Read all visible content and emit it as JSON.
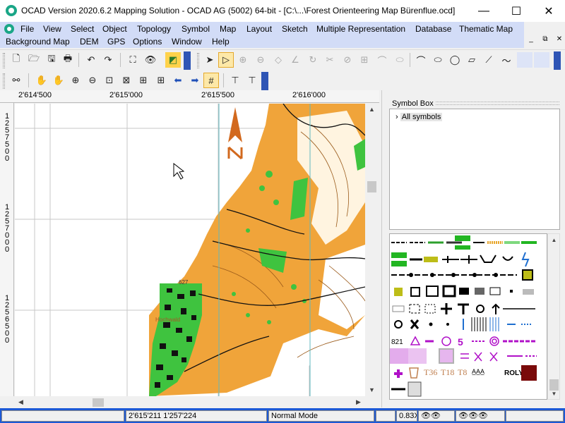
{
  "window": {
    "title": "OCAD Version 2020.6.2 Mapping Solution - OCAD AG (5002) 64-bit - [C:\\...\\Forest Orienteering Map Bürenflue.ocd]",
    "minimize_glyph": "—",
    "maximize_glyph": "☐",
    "close_glyph": "✕"
  },
  "menu": {
    "items": [
      "File",
      "View",
      "Select",
      "Object",
      "Topology",
      "Symbol",
      "Map",
      "Layout",
      "Sketch",
      "Multiple Representation",
      "Database",
      "Thematic Map",
      "Background Map",
      "DEM",
      "GPS",
      "Options",
      "Window",
      "Help"
    ],
    "mdi_minimize": "_",
    "mdi_restore": "⧉",
    "mdi_close": "✕"
  },
  "toolbar1": {
    "icons": [
      "new-file-icon",
      "open-folder-icon",
      "save-icon",
      "print-icon",
      "undo-icon",
      "redo-icon",
      "fullscreen-icon",
      "eye-icon",
      "layers-icon",
      "pointer-icon",
      "edit-object-icon",
      "add-vertex-icon",
      "remove-vertex-icon",
      "move-vertex-icon",
      "straight-corner-icon",
      "rotate-icon",
      "cut-icon",
      "cut-hole-icon",
      "merge-icon",
      "curve-icon",
      "ellipse-icon",
      "circle-icon",
      "rectangle-icon",
      "line-icon",
      "freehand-icon"
    ],
    "glyphs": [
      "🗋",
      "🗁",
      "🖫",
      "🖶",
      "↶",
      "↷",
      "⛶",
      "👁",
      "◩",
      "➤",
      "▷",
      "⊕",
      "⊖",
      "◇",
      "∠",
      "↻",
      "✂",
      "⊘",
      "⊞",
      "⌒",
      "⬭",
      "◯",
      "▱",
      "⟋",
      "〜"
    ]
  },
  "toolbar2": {
    "icons": [
      "binoculars-icon",
      "pan-hand-icon",
      "pan-hand2-icon",
      "zoom-in-icon",
      "zoom-out-icon",
      "zoom-window-icon",
      "zoom-fit-icon",
      "zoom-selection-icon",
      "back-arrow-icon",
      "forward-arrow-icon",
      "grid-icon",
      "table-icon",
      "table2-icon"
    ],
    "glyphs": [
      "⚯",
      "✋",
      "✋",
      "⊕",
      "⊖",
      "⊡",
      "⊠",
      "⊞",
      "⬅",
      "➡",
      "#",
      "⊤",
      "⊤"
    ]
  },
  "ruler": {
    "x_labels": [
      "2'614'500",
      "2'615'000",
      "2'615'500",
      "2'616'000"
    ],
    "y_labels": [
      "1257500",
      "1257000",
      "1256500"
    ]
  },
  "map": {
    "label_height": "627",
    "label_place": "Hochwald"
  },
  "panel": {
    "symbol_box_title": "Symbol Box",
    "tree_root": "All symbols",
    "tree_expander": "›"
  },
  "symbols": {
    "text_821": "821",
    "text_5": "5",
    "text_t36": "T36",
    "text_t18": "T18",
    "text_t8": "T8",
    "text_roly": "ROLY",
    "text_aaa": "A̲A̲A̲"
  },
  "status": {
    "coordinates": "2'615'211   1'257'224",
    "mode": "Normal Mode",
    "zoom": "0.83X"
  },
  "colors": {
    "menubar": "#d2dcf7",
    "statusbar": "#1c59d6",
    "map_orange": "#f0a43a",
    "map_green": "#3fc33f",
    "map_black": "#111111",
    "symbol_purple": "#b010c8",
    "symbol_olive": "#bdbd18",
    "symbol_darkred": "#7a0a0a"
  }
}
